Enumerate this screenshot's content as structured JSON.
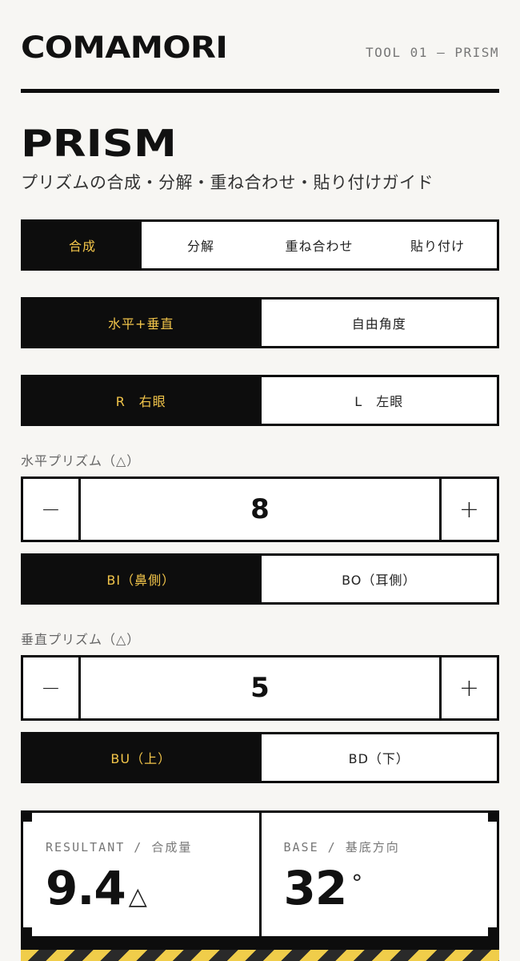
{
  "header": {
    "brand": "COMAMORI",
    "tool_id": "TOOL 01 — PRISM"
  },
  "page": {
    "title": "PRISM",
    "subtitle": "プリズムの合成・分解・重ね合わせ・貼り付けガイド"
  },
  "mode_tabs": {
    "items": [
      "合成",
      "分解",
      "重ね合わせ",
      "貼り付け"
    ],
    "active": 0
  },
  "axis_toggle": {
    "items": [
      "水平+垂直",
      "自由角度"
    ],
    "active": 0
  },
  "eye_toggle": {
    "items": [
      "R　右眼",
      "L　左眼"
    ],
    "active": 0
  },
  "horizontal": {
    "label": "水平プリズム（△）",
    "minus": "−",
    "plus": "+",
    "value": "8",
    "base_options": [
      "BI（鼻側）",
      "BO（耳側）"
    ],
    "base_active": 0
  },
  "vertical": {
    "label": "垂直プリズム（△）",
    "minus": "−",
    "plus": "+",
    "value": "5",
    "base_options": [
      "BU（上）",
      "BD（下）"
    ],
    "base_active": 0
  },
  "result": {
    "resultant_label": "RESULTANT / 合成量",
    "resultant_value": "9.4",
    "resultant_unit": "△",
    "base_label": "BASE / 基底方向",
    "base_value": "32",
    "base_unit": "°"
  },
  "colors": {
    "ink": "#0d0d0d",
    "accent": "#f2c54a",
    "background": "#f7f6f3"
  }
}
